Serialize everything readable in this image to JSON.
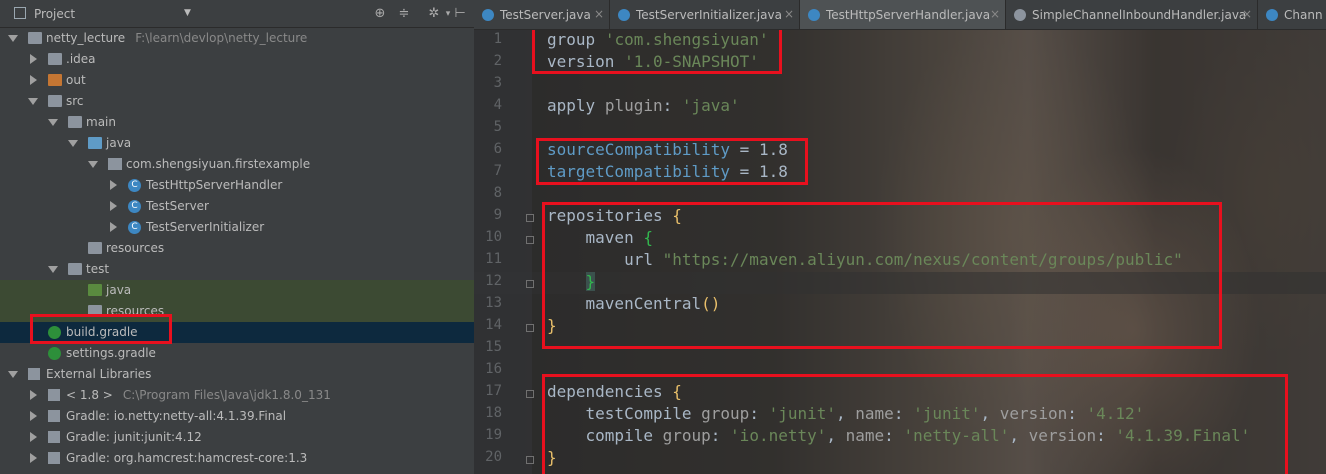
{
  "project_panel": {
    "title": "Project",
    "tree": [
      {
        "label": "netty_lecture",
        "path": "F:\\learn\\devlop\\netty_lecture",
        "icon": "folder-icon"
      },
      {
        "label": ".idea",
        "icon": "folder-icon"
      },
      {
        "label": "out",
        "icon": "folder-orange-icon"
      },
      {
        "label": "src",
        "icon": "folder-icon"
      },
      {
        "label": "main",
        "icon": "folder-icon"
      },
      {
        "label": "java",
        "icon": "source-folder-icon"
      },
      {
        "label": "com.shengsiyuan.firstexample",
        "icon": "package-icon"
      },
      {
        "label": "TestHttpServerHandler",
        "icon": "class-icon"
      },
      {
        "label": "TestServer",
        "icon": "class-icon"
      },
      {
        "label": "TestServerInitializer",
        "icon": "class-icon"
      },
      {
        "label": "resources",
        "icon": "resources-folder-icon"
      },
      {
        "label": "test",
        "icon": "folder-icon"
      },
      {
        "label": "java",
        "icon": "test-folder-icon"
      },
      {
        "label": "resources",
        "icon": "resources-folder-icon"
      },
      {
        "label": "build.gradle",
        "icon": "gradle-icon"
      },
      {
        "label": "settings.gradle",
        "icon": "gradle-icon"
      },
      {
        "label": "External Libraries",
        "icon": "library-icon"
      },
      {
        "label": "< 1.8 >",
        "path": "C:\\Program Files\\Java\\jdk1.8.0_131",
        "icon": "jdk-icon"
      },
      {
        "label": "Gradle: io.netty:netty-all:4.1.39.Final",
        "icon": "library-icon"
      },
      {
        "label": "Gradle: junit:junit:4.12",
        "icon": "library-icon"
      },
      {
        "label": "Gradle: org.hamcrest:hamcrest-core:1.3",
        "icon": "library-icon"
      }
    ]
  },
  "tabs": [
    {
      "label": "TestServer.java"
    },
    {
      "label": "TestServerInitializer.java"
    },
    {
      "label": "TestHttpServerHandler.java"
    },
    {
      "label": "SimpleChannelInboundHandler.java"
    },
    {
      "label": "Chann"
    }
  ],
  "editor": {
    "line_numbers": [
      "1",
      "2",
      "3",
      "4",
      "5",
      "6",
      "7",
      "8",
      "9",
      "10",
      "11",
      "12",
      "13",
      "14",
      "15",
      "16",
      "17",
      "18",
      "19",
      "20"
    ],
    "code": {
      "l1_kw": "group",
      "l1_val": "'com.shengsiyuan'",
      "l2_kw": "version",
      "l2_val": "'1.0-SNAPSHOT'",
      "l4_kw": "apply",
      "l4_named": "plugin",
      "l4_colon": ":",
      "l4_val": "'java'",
      "l6_prop": "sourceCompatibility",
      "l6_eq": " = ",
      "l6_num": "1.8",
      "l7_prop": "targetCompatibility",
      "l7_eq": " = ",
      "l7_num": "1.8",
      "l9_kw": "repositories",
      "l9_brace": "{",
      "l10_kw": "maven",
      "l10_brace": "{",
      "l11_kw": "url",
      "l11_val": "\"https://maven.aliyun.com/nexus/content/groups/public\"",
      "l12_brace": "}",
      "l13_kw": "mavenCentral",
      "l13_paren": "()",
      "l14_brace": "}",
      "l17_kw": "dependencies",
      "l17_brace": "{",
      "l18_kw": "testCompile",
      "l18_g": "group",
      "l18_gv": "'junit'",
      "l18_n": "name",
      "l18_nv": "'junit'",
      "l18_v": "version",
      "l18_vv": "'4.12'",
      "l19_kw": "compile",
      "l19_g": "group",
      "l19_gv": "'io.netty'",
      "l19_n": "name",
      "l19_nv": "'netty-all'",
      "l19_v": "version",
      "l19_vv": "'4.1.39.Final'",
      "l20_brace": "}"
    }
  }
}
